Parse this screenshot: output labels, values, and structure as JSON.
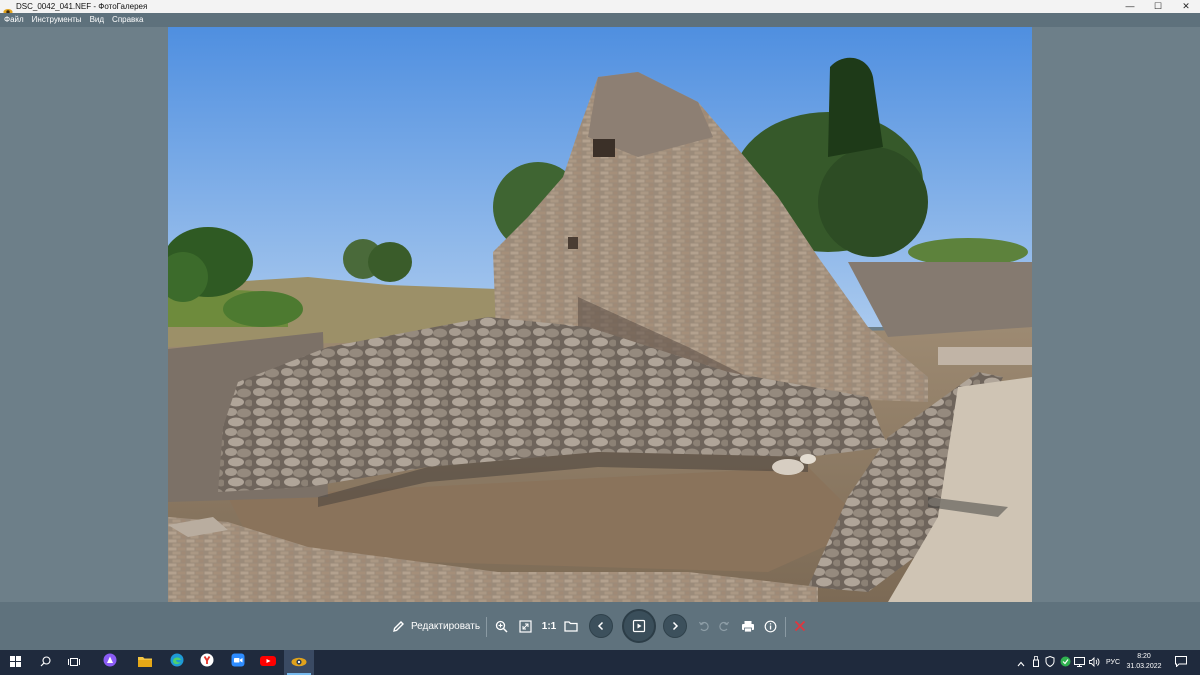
{
  "window": {
    "title": "DSC_0042_041.NEF - ФотоГалерея",
    "minimize_glyph": "—",
    "maximize_glyph": "☐",
    "close_glyph": "✕"
  },
  "menu": {
    "items": [
      {
        "label": "Файл"
      },
      {
        "label": "Инструменты"
      },
      {
        "label": "Вид"
      },
      {
        "label": "Справка"
      }
    ]
  },
  "photo": {
    "subject": "ancient stone ruins under blue sky"
  },
  "toolbar": {
    "edit_label": "Редактировать",
    "actual_size_label": "1:1",
    "icons": [
      "pencil-icon",
      "zoom-in-icon",
      "fit-to-window-icon",
      "folder-icon",
      "previous-icon",
      "slideshow-icon",
      "next-icon",
      "rotate-left-icon",
      "rotate-right-icon",
      "print-icon",
      "info-icon",
      "delete-icon"
    ],
    "delete_color": "#e0363e"
  },
  "taskbar": {
    "apps": [
      "windows-start",
      "search",
      "task-view",
      "alice-assistant",
      "file-explorer",
      "edge-browser",
      "yandex-browser",
      "zoom",
      "youtube",
      "photo-gallery"
    ],
    "language": "РУС",
    "time": "8:20",
    "date": "31.03.2022"
  }
}
